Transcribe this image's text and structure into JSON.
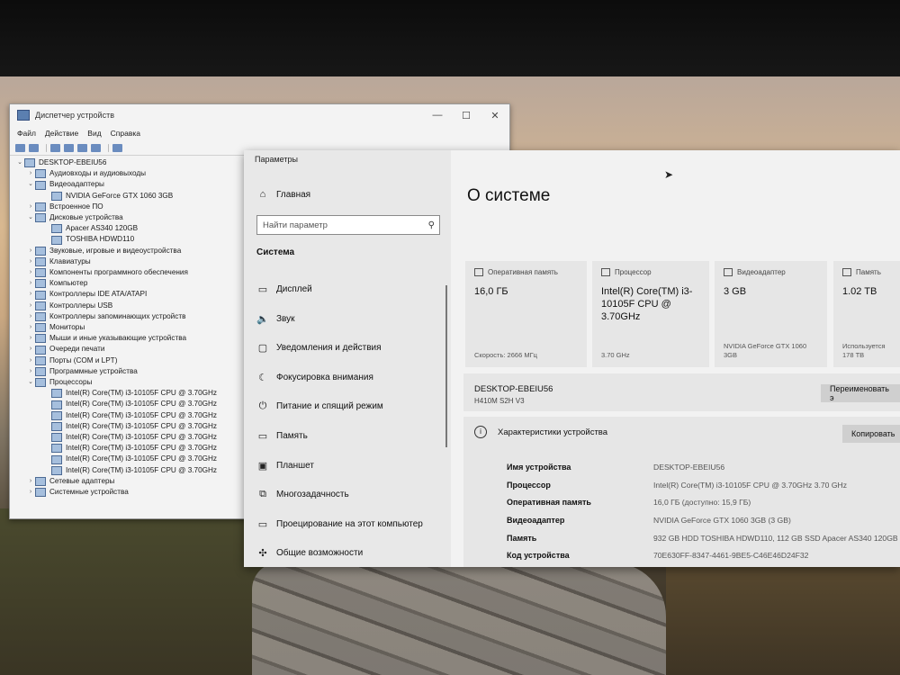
{
  "device_manager": {
    "title": "Диспетчер устройств",
    "menu": [
      "Файл",
      "Действие",
      "Вид",
      "Справка"
    ],
    "tree": [
      {
        "label": "DESKTOP-EBEIU56",
        "level": 0,
        "arrow": "⌄"
      },
      {
        "label": "Аудиовходы и аудиовыходы",
        "level": 1,
        "arrow": "›"
      },
      {
        "label": "Видеоадаптеры",
        "level": 1,
        "arrow": "⌄"
      },
      {
        "label": "NVIDIA GeForce GTX 1060 3GB",
        "level": 2,
        "arrow": ""
      },
      {
        "label": "Встроенное ПО",
        "level": 1,
        "arrow": "›"
      },
      {
        "label": "Дисковые устройства",
        "level": 1,
        "arrow": "⌄"
      },
      {
        "label": "Apacer AS340 120GB",
        "level": 2,
        "arrow": ""
      },
      {
        "label": "TOSHIBA HDWD110",
        "level": 2,
        "arrow": ""
      },
      {
        "label": "Звуковые, игровые и видеоустройства",
        "level": 1,
        "arrow": "›"
      },
      {
        "label": "Клавиатуры",
        "level": 1,
        "arrow": "›"
      },
      {
        "label": "Компоненты программного обеспечения",
        "level": 1,
        "arrow": "›"
      },
      {
        "label": "Компьютер",
        "level": 1,
        "arrow": "›"
      },
      {
        "label": "Контроллеры IDE ATA/ATAPI",
        "level": 1,
        "arrow": "›"
      },
      {
        "label": "Контроллеры USB",
        "level": 1,
        "arrow": "›"
      },
      {
        "label": "Контроллеры запоминающих устройств",
        "level": 1,
        "arrow": "›"
      },
      {
        "label": "Мониторы",
        "level": 1,
        "arrow": "›"
      },
      {
        "label": "Мыши и иные указывающие устройства",
        "level": 1,
        "arrow": "›"
      },
      {
        "label": "Очереди печати",
        "level": 1,
        "arrow": "›"
      },
      {
        "label": "Порты (COM и LPT)",
        "level": 1,
        "arrow": "›"
      },
      {
        "label": "Программные устройства",
        "level": 1,
        "arrow": "›"
      },
      {
        "label": "Процессоры",
        "level": 1,
        "arrow": "⌄"
      },
      {
        "label": "Intel(R) Core(TM) i3-10105F CPU @ 3.70GHz",
        "level": 2,
        "arrow": ""
      },
      {
        "label": "Intel(R) Core(TM) i3-10105F CPU @ 3.70GHz",
        "level": 2,
        "arrow": ""
      },
      {
        "label": "Intel(R) Core(TM) i3-10105F CPU @ 3.70GHz",
        "level": 2,
        "arrow": ""
      },
      {
        "label": "Intel(R) Core(TM) i3-10105F CPU @ 3.70GHz",
        "level": 2,
        "arrow": ""
      },
      {
        "label": "Intel(R) Core(TM) i3-10105F CPU @ 3.70GHz",
        "level": 2,
        "arrow": ""
      },
      {
        "label": "Intel(R) Core(TM) i3-10105F CPU @ 3.70GHz",
        "level": 2,
        "arrow": ""
      },
      {
        "label": "Intel(R) Core(TM) i3-10105F CPU @ 3.70GHz",
        "level": 2,
        "arrow": ""
      },
      {
        "label": "Intel(R) Core(TM) i3-10105F CPU @ 3.70GHz",
        "level": 2,
        "arrow": ""
      },
      {
        "label": "Сетевые адаптеры",
        "level": 1,
        "arrow": "›"
      },
      {
        "label": "Системные устройства",
        "level": 1,
        "arrow": "›"
      }
    ]
  },
  "settings": {
    "title": "Параметры",
    "home": "Главная",
    "search_placeholder": "Найти параметр",
    "section": "Система",
    "nav": [
      {
        "label": "Дисплей",
        "icon": "display-icon"
      },
      {
        "label": "Звук",
        "icon": "sound-icon"
      },
      {
        "label": "Уведомления и действия",
        "icon": "notifications-icon"
      },
      {
        "label": "Фокусировка внимания",
        "icon": "focus-assist-icon"
      },
      {
        "label": "Питание и спящий режим",
        "icon": "power-icon"
      },
      {
        "label": "Память",
        "icon": "storage-icon"
      },
      {
        "label": "Планшет",
        "icon": "tablet-icon"
      },
      {
        "label": "Многозадачность",
        "icon": "multitasking-icon"
      },
      {
        "label": "Проецирование на этот компьютер",
        "icon": "projecting-icon"
      },
      {
        "label": "Общие возможности",
        "icon": "shared-experiences-icon"
      }
    ],
    "page_title": "О системе",
    "cards": [
      {
        "header": "Оперативная память",
        "value": "16,0 ГБ",
        "sub": "Скорость: 2666 МГц"
      },
      {
        "header": "Процессор",
        "value": "Intel(R) Core(TM) i3-10105F CPU @ 3.70GHz",
        "sub": "3.70 GHz"
      },
      {
        "header": "Видеоадаптер",
        "value": "3 GB",
        "sub": "NVIDIA GeForce GTX 1060 3GB"
      },
      {
        "header": "Память",
        "value": "1.02 TB",
        "sub": "Используется 178 TB"
      }
    ],
    "device_name": "DESKTOP-EBEIU56",
    "device_model": "H410M S2H V3",
    "rename_button": "Переименовать э",
    "specs_header": "Характеристики устройства",
    "copy_button": "Копировать",
    "specs": [
      {
        "key": "Имя устройства",
        "value": "DESKTOP-EBEIU56"
      },
      {
        "key": "Процессор",
        "value": "Intel(R) Core(TM) i3-10105F CPU @ 3.70GHz   3.70 GHz"
      },
      {
        "key": "Оперативная память",
        "value": "16,0 ГБ (доступно: 15,9 ГБ)"
      },
      {
        "key": "Видеоадаптер",
        "value": "NVIDIA GeForce GTX 1060 3GB (3 GB)"
      },
      {
        "key": "Память",
        "value": "932 GB HDD TOSHIBA HDWD110, 112 GB SSD Apacer AS340 120GB"
      },
      {
        "key": "Код устройства",
        "value": "70E630FF-8347-4461-9BE5-C46E46D24F32"
      }
    ]
  }
}
